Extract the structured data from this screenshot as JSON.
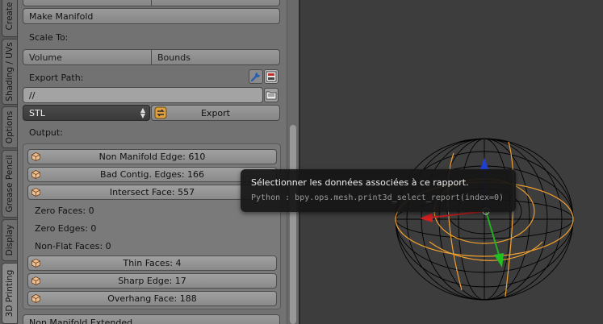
{
  "tabs": [
    "Create",
    "Shading / UVs",
    "Options",
    "Grease Pencil",
    "Display",
    "3D Printing"
  ],
  "panel": {
    "make_manifold": "Make Manifold",
    "scale_to_label": "Scale To:",
    "scale_to_volume": "Volume",
    "scale_to_bounds": "Bounds",
    "export_path_label": "Export Path:",
    "export_path_value": "//",
    "format_value": "STL",
    "export_button": "Export",
    "output_label": "Output:",
    "report_items": [
      "Non Manifold Edge: 610",
      "Bad Contig. Edges: 166",
      "Intersect Face: 557"
    ],
    "report_texts": [
      "Zero Faces: 0",
      "Zero Edges: 0",
      "Non-Flat Faces: 0"
    ],
    "report_items2": [
      "Thin Faces: 4",
      "Sharp Edge: 17",
      "Overhang Face: 188"
    ],
    "bottom_partial": "Non Manifold Extended"
  },
  "tooltip": {
    "title": "Sélectionner les données associées à ce rapport.",
    "python": "Python : bpy.ops.mesh.print3d_select_report(index=0)"
  },
  "colors": {
    "panel_bg": "#727272",
    "viewport_bg": "#3d3d3d",
    "tooltip_bg": "#161616",
    "mesh_highlight": "#f0a030"
  }
}
